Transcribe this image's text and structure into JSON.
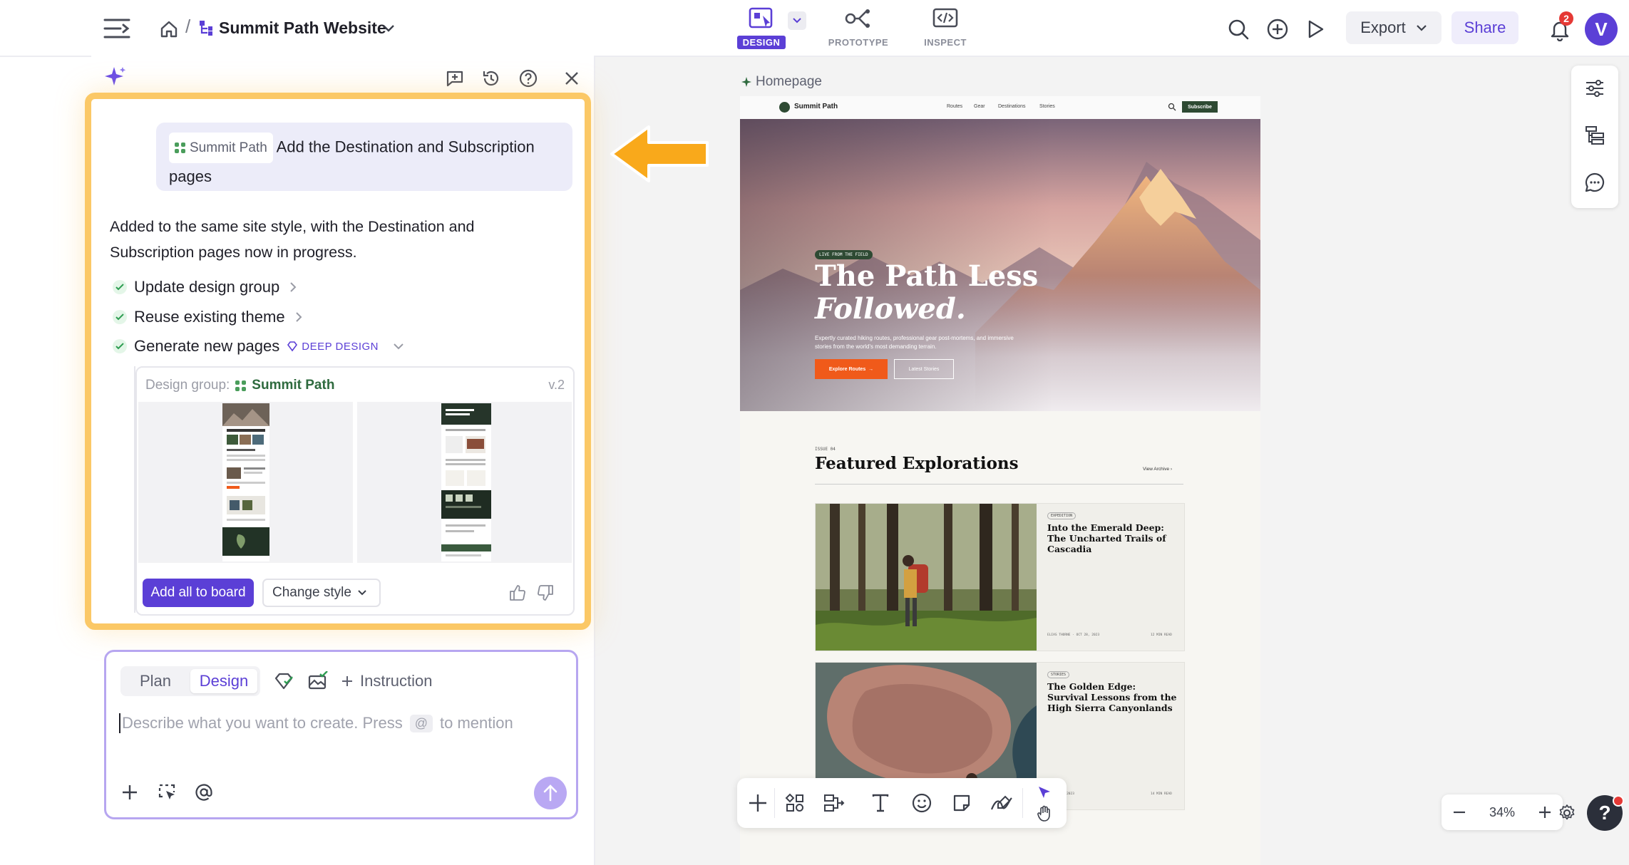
{
  "header": {
    "project_title": "Summit Path Website",
    "mode_tabs": [
      {
        "label": "DESIGN",
        "active": true
      },
      {
        "label": "PROTOTYPE",
        "active": false
      },
      {
        "label": "INSPECT",
        "active": false
      }
    ],
    "export_label": "Export",
    "share_label": "Share",
    "notification_count": "2",
    "avatar_letter": "V"
  },
  "chat": {
    "user_message": {
      "chip_label": "Summit Path",
      "text": "Add the Destination and Subscription pages"
    },
    "response_text": "Added to the same site style, with the Destination and Subscription pages now in progress.",
    "steps": [
      {
        "label": "Update design group"
      },
      {
        "label": "Reuse existing theme"
      },
      {
        "label": "Generate new pages",
        "badge": "DEEP DESIGN"
      }
    ],
    "design_group": {
      "prefix": "Design group:",
      "name": "Summit Path",
      "version": "v.2",
      "add_button": "Add all to board",
      "change_style_button": "Change style"
    }
  },
  "composer": {
    "mode_plan": "Plan",
    "mode_design": "Design",
    "instruction_label": "Instruction",
    "placeholder_before": "Describe what you want to create. Press",
    "mention_key": "@",
    "placeholder_after": "to mention"
  },
  "canvas": {
    "frame_label": "Homepage",
    "zoom": "34%"
  },
  "site": {
    "brand": "Summit Path",
    "nav": [
      "Routes",
      "Gear",
      "Destinations",
      "Stories"
    ],
    "subscribe": "Subscribe",
    "hero_tag": "LIVE FROM THE FIELD",
    "hero_title_1": "The Path Less",
    "hero_title_2": "Followed.",
    "hero_sub": "Expertly curated hiking routes, professional gear post-mortems, and immersive stories from the world's most demanding terrain.",
    "hero_btn_primary": "Explore Routes",
    "hero_btn_secondary": "Latest Stories",
    "issue_label": "ISSUE 04",
    "section_title": "Featured Explorations",
    "view_archive": "View Archive",
    "stories": [
      {
        "tag": "EXPEDITION",
        "title": "Into the Emerald Deep: The Uncharted Trails of Cascadia",
        "meta_left": "ELIAS THORNE · OCT 28, 2023",
        "meta_right": "12 MIN READ"
      },
      {
        "tag": "STORIES",
        "title": "The Golden Edge: Survival Lessons from the High Sierra Canyonlands",
        "meta_left": "· OCT 21, 2023",
        "meta_right": "14 MIN READ"
      }
    ]
  },
  "colors": {
    "accent": "#5b3fd6",
    "highlight_frame": "#fbc866",
    "arrow": "#f9a91b",
    "site_orange": "#f05a1a",
    "site_green": "#2e4a33"
  }
}
